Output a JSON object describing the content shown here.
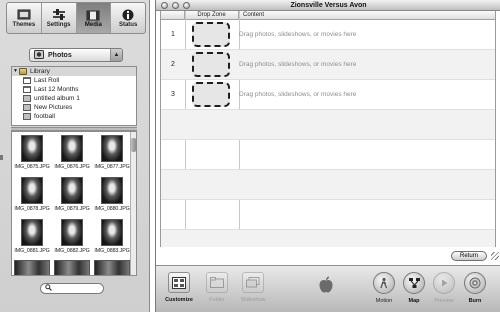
{
  "pane_tabs": [
    {
      "label": "Themes",
      "icon": "themes-icon",
      "active": false
    },
    {
      "label": "Settings",
      "icon": "settings-icon",
      "active": false
    },
    {
      "label": "Media",
      "icon": "media-icon",
      "active": true
    },
    {
      "label": "Status",
      "icon": "status-icon",
      "active": false
    }
  ],
  "source_select": {
    "selected": "Photos",
    "icon": "iphoto-icon"
  },
  "library_tree": {
    "root": {
      "label": "Library",
      "icon": "folder-icon"
    },
    "items": [
      {
        "label": "Last Roll",
        "icon": "calendar-icon"
      },
      {
        "label": "Last 12 Months",
        "icon": "calendar-icon"
      },
      {
        "label": "untitled album 1",
        "icon": "album-icon"
      },
      {
        "label": "New Pictures",
        "icon": "album-icon"
      },
      {
        "label": "football",
        "icon": "album-icon"
      }
    ]
  },
  "thumbnails": [
    "IMG_0875.JPG",
    "IMG_0876.JPG",
    "IMG_0877.JPG",
    "IMG_0878.JPG",
    "IMG_0879.JPG",
    "IMG_0880.JPG",
    "IMG_0881.JPG",
    "IMG_0882.JPG",
    "IMG_0883.JPG"
  ],
  "search": {
    "value": "",
    "icon": "magnifier-icon"
  },
  "window": {
    "title": "Zionsville Versus Avon"
  },
  "table": {
    "headers": {
      "number": "",
      "drop_zone": "Drop Zone",
      "content": "Content"
    },
    "rows": [
      {
        "number": "1",
        "hint": "Drag photos, slideshows, or movies here"
      },
      {
        "number": "2",
        "hint": "Drag photos, slideshows, or movies here"
      },
      {
        "number": "3",
        "hint": "Drag photos, slideshows, or movies here"
      }
    ]
  },
  "return_button": "Return",
  "toolbar": {
    "customize": "Customize",
    "folder": "Folder",
    "slideshow": "Slideshow",
    "motion": "Motion",
    "map": "Map",
    "preview": "Preview",
    "burn": "Burn"
  }
}
